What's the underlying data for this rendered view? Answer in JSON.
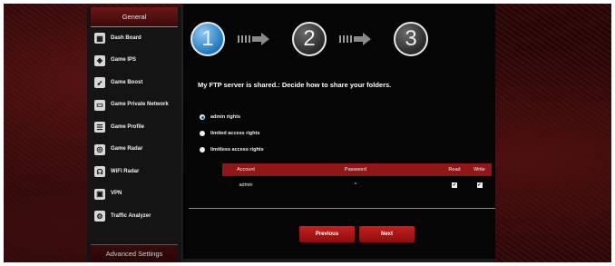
{
  "sidebar": {
    "general_label": "General",
    "items": [
      {
        "label": "Dash Board",
        "icon": "dashboard-icon"
      },
      {
        "label": "Game IPS",
        "icon": "shield-icon"
      },
      {
        "label": "Game Boost",
        "icon": "rocket-icon"
      },
      {
        "label": "Game Private Network",
        "icon": "network-icon"
      },
      {
        "label": "Game Profile",
        "icon": "profile-icon"
      },
      {
        "label": "Game Radar",
        "icon": "radar-icon"
      },
      {
        "label": "WiFi Radar",
        "icon": "wifi-icon"
      },
      {
        "label": "VPN",
        "icon": "vpn-icon"
      },
      {
        "label": "Traffic Analyzer",
        "icon": "traffic-icon"
      }
    ],
    "advanced_label": "Advanced Settings"
  },
  "stepper": {
    "steps": [
      "1",
      "2",
      "3"
    ],
    "active_step": 1
  },
  "main": {
    "title": "My FTP server is shared.: Decide how to share your folders.",
    "options": [
      {
        "label": "admin rights",
        "selected": true
      },
      {
        "label": "limited access rights",
        "selected": false
      },
      {
        "label": "limitless access rights",
        "selected": false
      }
    ],
    "table": {
      "headers": [
        "Account",
        "Password",
        "Read",
        "Write"
      ],
      "rows": [
        {
          "account": "admin",
          "password": "*",
          "read": true,
          "write": true
        }
      ]
    },
    "buttons": {
      "previous": "Previous",
      "next": "Next"
    }
  },
  "colors": {
    "accent_red": "#8f1717",
    "step_active": "#1e79c2",
    "panel_bg": "#050505"
  }
}
